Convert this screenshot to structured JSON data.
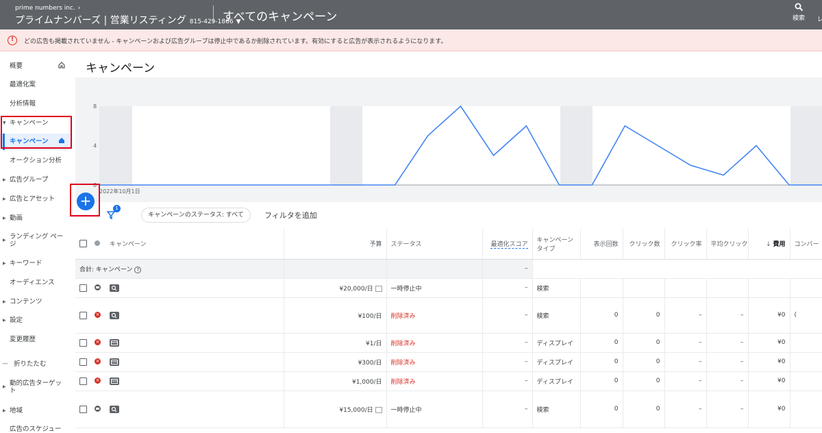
{
  "topbar": {
    "company": "prime numbers inc.",
    "account_name": "プライムナンバーズ | 営業リスティング",
    "account_id": "815-429-1866",
    "page_title": "すべてのキャンペーン",
    "search_label": "検索",
    "edge_label": "レ"
  },
  "alert": {
    "icon": "!",
    "message": "どの広告も掲載されていません - キャンペーンおよび広告グループは停止中であるか削除されています。有効にすると広告が表示されるようになります。"
  },
  "sidebar": {
    "items": [
      {
        "label": "概要"
      },
      {
        "label": "最適化案"
      },
      {
        "label": "分析情報"
      },
      {
        "label": "キャンペーン"
      },
      {
        "label": "キャンペーン"
      },
      {
        "label": "オークション分析"
      },
      {
        "label": "広告グループ"
      },
      {
        "label": "広告とアセット"
      },
      {
        "label": "動画"
      },
      {
        "label": "ランディング ページ"
      },
      {
        "label": "キーワード"
      },
      {
        "label": "オーディエンス"
      },
      {
        "label": "コンテンツ"
      },
      {
        "label": "設定"
      },
      {
        "label": "変更履歴"
      },
      {
        "label": "折りたたむ"
      },
      {
        "label": "動的広告ターゲット"
      },
      {
        "label": "地域"
      },
      {
        "label": "広告のスケジュー"
      }
    ]
  },
  "main": {
    "title": "キャンペーン",
    "fab": "+",
    "filter_badge": "1",
    "status_chip": "キャンペーンのステータス: すべて",
    "add_filter": "フィルタを追加"
  },
  "chart_data": {
    "type": "line",
    "x_start_label": "2022年10月1日",
    "y_ticks": [
      "8",
      "4",
      "0"
    ],
    "ylim": [
      0,
      8
    ],
    "series": [
      {
        "values": [
          0,
          0,
          0,
          0,
          0,
          0,
          0,
          0,
          0,
          0,
          5,
          8,
          3,
          6,
          0,
          0,
          6,
          4,
          2,
          1,
          4,
          0,
          0
        ]
      }
    ],
    "color": "#4285f4"
  },
  "table": {
    "headers": {
      "campaign": "キャンペーン",
      "budget": "予算",
      "status": "ステータス",
      "opt_score": "最適化スコア",
      "type": "キャンペーン タイプ",
      "impr": "表示回数",
      "clicks": "クリック数",
      "ctr": "クリック率",
      "avg_cpc": "平均クリック",
      "cost": "費用",
      "conv": "コンバー"
    },
    "total": {
      "label": "合計: キャンペーン",
      "help": "?",
      "opt": "–"
    },
    "rows": [
      {
        "budget": "¥20,000/日",
        "status": "一時停止中",
        "opt": "–",
        "type": "検索",
        "impr": "",
        "clicks": "",
        "ctr": "",
        "cpc": "",
        "cost": "",
        "conv": ""
      },
      {
        "budget": "¥100/日",
        "status": "削除済み",
        "opt": "–",
        "type": "検索",
        "impr": "0",
        "clicks": "0",
        "ctr": "–",
        "cpc": "–",
        "cost": "¥0",
        "conv": "("
      },
      {
        "budget": "¥1/日",
        "status": "削除済み",
        "opt": "–",
        "type": "ディスプレイ",
        "impr": "0",
        "clicks": "0",
        "ctr": "–",
        "cpc": "–",
        "cost": "¥0",
        "conv": ""
      },
      {
        "budget": "¥300/日",
        "status": "削除済み",
        "opt": "–",
        "type": "ディスプレイ",
        "impr": "0",
        "clicks": "0",
        "ctr": "–",
        "cpc": "–",
        "cost": "¥0",
        "conv": ""
      },
      {
        "budget": "¥1,000/日",
        "status": "削除済み",
        "opt": "–",
        "type": "ディスプレイ",
        "impr": "0",
        "clicks": "0",
        "ctr": "–",
        "cpc": "–",
        "cost": "¥0",
        "conv": ""
      },
      {
        "budget": "¥15,000/日",
        "status": "一時停止中",
        "opt": "–",
        "type": "検索",
        "impr": "0",
        "clicks": "0",
        "ctr": "–",
        "cpc": "–",
        "cost": "¥0",
        "conv": ""
      }
    ]
  }
}
